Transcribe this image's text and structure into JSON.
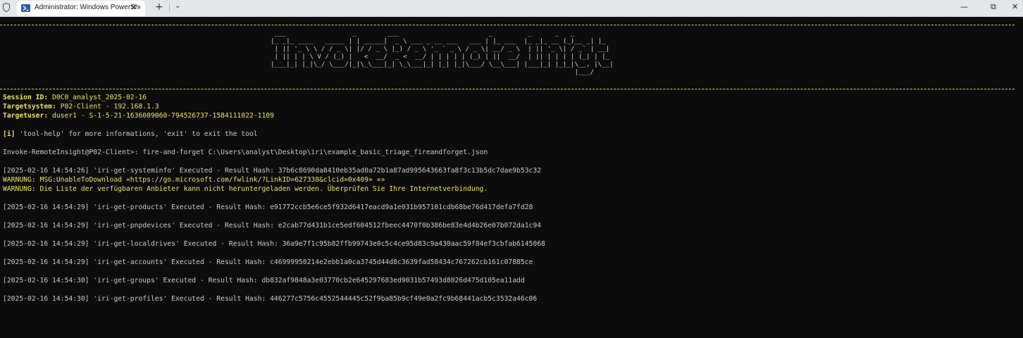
{
  "window": {
    "tab_title": "Administrator: Windows PowerShell",
    "new_tab": "+",
    "dropdown": "⌄",
    "close_tab": "✕",
    "controls": {
      "minimize": "—",
      "maximize": "⧉",
      "close": "✕"
    },
    "icons": [
      "shield-icon",
      "powershell-icon"
    ]
  },
  "terminal": {
    "banner": [
      " ___                 _        ___                       _         _      _   _   ",
      "|_ _|_ ____   _____ | | _____|  _ \\ ___ _ __ ___   ___ | |_ ___  |_ _|_ __ (_)__ _| |_ ",
      " | || '_ \\ \\ / / _ \\| |/ / _ \\ |_) / _ \\ '_ ` _ \\ / _ \\| __/ _ \\  | || '_ \\| / _` | __|",
      " | || | | \\ V / (_) |   <  __/  _ <  __/ | | | | | (_) | ||  __/  | || | | | | (_| | |_ ",
      "|___|_| |_|\\_/ \\___/|_|\\_\\___|_| \\_\\___|_| |_| |_|\\___/ \\__\\___| |___|_| |_|_|\\__, |\\__|",
      "                                                                              |___/      "
    ],
    "session": {
      "id_label": "Session ID:",
      "id_value": " D0C0_analyst_2025-02-16",
      "target_label": "Targetsystem:",
      "target_value": " P02-Client - 192.168.1.3",
      "user_label": "Targetuser:",
      "user_value": " duser1 - S-1-5-21-1636009060-794526737-1584111022-1109"
    },
    "info": {
      "tag": "[i]",
      "text": " 'tool-help' for more informations, 'exit' to exit the tool"
    },
    "prompt": "Invoke-RemoteInsight@P02-Client>: fire-and-forget C:\\Users\\analyst\\Desktop\\iri\\example_basic_triage_fireandforget.json",
    "line_systeminfo": "[2025-02-16 14:54:26] 'iri-get-systeminfo' Executed - Result Hash: 37b6c8690da8410eb35ad0a72b1a87ad995643663fa8f3c13b5dc7dae9b53c32",
    "warnings": [
      "WARNUNG: MSG:UnableToDownload «https://go.microsoft.com/fwlink/?LinkID=627338&clcid=0x409» «»",
      "WARNUNG: Die Liste der verfügbaren Anbieter kann nicht heruntergeladen werden. Überprüfen Sie Ihre Internetverbindung."
    ],
    "results": [
      "[2025-02-16 14:54:29] 'iri-get-products' Executed - Result Hash: e91772ccb5e6ce5f932d6417eacd9a1e031b957101cdb68be76d417defa7fd28",
      "[2025-02-16 14:54:29] 'iri-get-pnpdevices' Executed - Result Hash: e2cab77d431b1ce5edf604512fbeec4470f0b386be83e4d4b26e07b072da1c94",
      "[2025-02-16 14:54:29] 'iri-get-localdrives' Executed - Result Hash: 36a9e7f1c95b82ffb99743e0c5c4ce95d83c9a430aac59f84ef3cbfab6145068",
      "[2025-02-16 14:54:29] 'iri-get-accounts' Executed - Result Hash: c46999950214e2ebb1a0ca3745d44d8c3639fad58434c767262cb161c07885ce",
      "[2025-02-16 14:54:30] 'iri-get-groups' Executed - Result Hash: db832af9848a3e03770cb2e645297683ed9031b57493d8026d475d105ea11add",
      "[2025-02-16 14:54:30] 'iri-get-profiles' Executed - Result Hash: 446277c5756c4552544445c52f9ba85b9cf49e0a2fc9b68441acb5c3532a46c06"
    ],
    "colors": {
      "background": "#0c0c0c",
      "text": "#cccccc",
      "accent_yellow": "#f0e55c"
    }
  }
}
